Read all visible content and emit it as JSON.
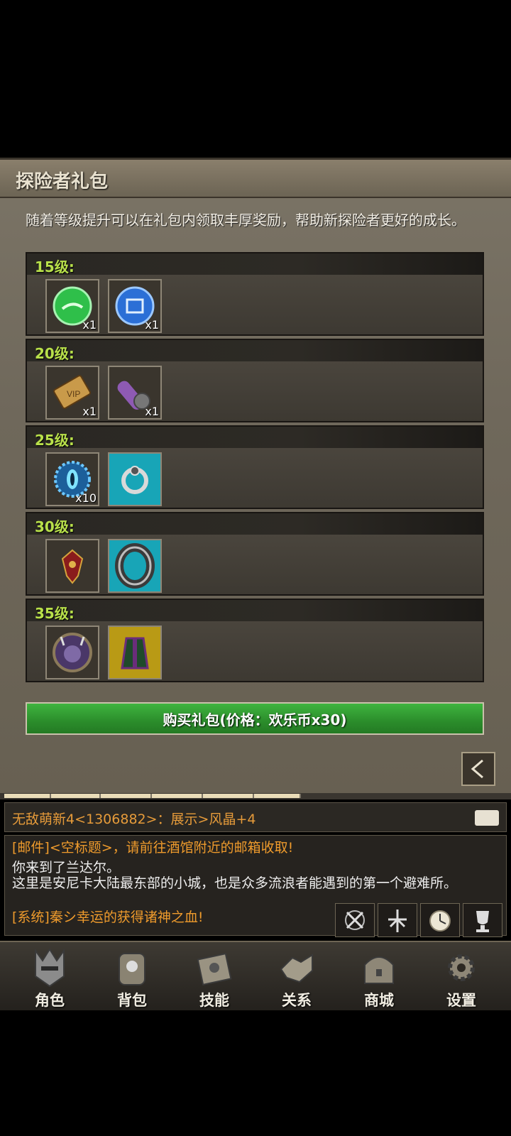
{
  "panel": {
    "title": "探险者礼包",
    "intro": "随着等级提升可以在礼包内领取丰厚奖励，帮助新探险者更好的成长。"
  },
  "tiers": [
    {
      "level": "15级:",
      "items": [
        {
          "icon": "green-orb-icon",
          "qty": "x1"
        },
        {
          "icon": "blue-book-orb-icon",
          "qty": "x1"
        }
      ]
    },
    {
      "level": "20级:",
      "items": [
        {
          "icon": "vip-card-icon",
          "qty": "x1"
        },
        {
          "icon": "purple-scroll-icon",
          "qty": "x1"
        }
      ]
    },
    {
      "level": "25级:",
      "items": [
        {
          "icon": "blue-eye-gem-icon",
          "qty": "x10"
        },
        {
          "icon": "silver-ring-icon",
          "qty": ""
        }
      ]
    },
    {
      "level": "30级:",
      "items": [
        {
          "icon": "red-amulet-icon",
          "qty": ""
        },
        {
          "icon": "engraved-ring-icon",
          "qty": ""
        }
      ]
    },
    {
      "level": "35级:",
      "items": [
        {
          "icon": "demon-portrait-icon",
          "qty": ""
        },
        {
          "icon": "green-robe-icon",
          "qty": ""
        }
      ]
    }
  ],
  "buy_button": "购买礼包(价格：欢乐币x30)",
  "chat": {
    "top_message": "无敌萌新4<1306882>：展示>风晶+4",
    "log": [
      {
        "text": "[邮件]<空标题>，请前往酒馆附近的邮箱收取!",
        "color": "orange"
      },
      {
        "text": "你来到了兰达尔。",
        "color": "white"
      },
      {
        "text": "这里是安尼卡大陆最东部的小城，也是众多流浪者能遇到的第一个避难所。",
        "color": "white"
      },
      {
        "text": "[系统]秦シ幸运的获得诸神之血!",
        "color": "orange"
      }
    ]
  },
  "nav": [
    {
      "label": "角色",
      "icon": "helmet-icon"
    },
    {
      "label": "背包",
      "icon": "backpack-icon"
    },
    {
      "label": "技能",
      "icon": "skill-book-icon"
    },
    {
      "label": "关系",
      "icon": "handshake-icon"
    },
    {
      "label": "商城",
      "icon": "chest-icon"
    },
    {
      "label": "设置",
      "icon": "gear-icon"
    }
  ],
  "colors": {
    "level_text": "#b8e04a",
    "buy_green": "#2b8d2b",
    "chat_orange": "#ef9b2c"
  }
}
